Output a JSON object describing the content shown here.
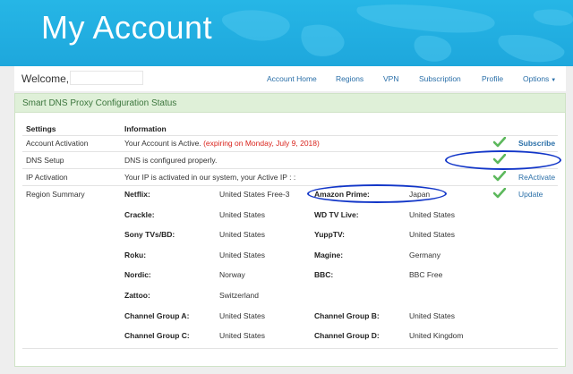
{
  "header": {
    "title": "My Account"
  },
  "navbar": {
    "welcome": "Welcome,",
    "links": [
      "Account Home",
      "Regions",
      "VPN",
      "Subscription",
      "Profile",
      "Options"
    ]
  },
  "panel": {
    "title": "Smart DNS Proxy Configuration Status",
    "col_settings": "Settings",
    "col_information": "Information",
    "rows": [
      {
        "setting": "Account Activation",
        "info": "Your Account is Active.",
        "info_extra": "(expiring on Monday, July 9, 2018)",
        "action": "Subscribe"
      },
      {
        "setting": "DNS Setup",
        "info": "DNS is configured properly.",
        "action": ""
      },
      {
        "setting": "IP Activation",
        "info": "Your IP is activated in our system, your Active IP : :",
        "action": "ReActivate"
      },
      {
        "setting": "Region Summary",
        "info": "",
        "action": "Update"
      }
    ]
  },
  "regions": [
    {
      "service": "Netflix:",
      "region": "United States Free-3"
    },
    {
      "service": "Amazon Prime:",
      "region": "Japan"
    },
    {
      "service": "Crackle:",
      "region": "United States"
    },
    {
      "service": "WD TV Live:",
      "region": "United States"
    },
    {
      "service": "Sony TVs/BD:",
      "region": "United States"
    },
    {
      "service": "YuppTV:",
      "region": "United States"
    },
    {
      "service": "Roku:",
      "region": "United States"
    },
    {
      "service": "Magine:",
      "region": "Germany"
    },
    {
      "service": "Nordic:",
      "region": "Norway"
    },
    {
      "service": "BBC:",
      "region": "BBC Free"
    },
    {
      "service": "Zattoo:",
      "region": "Switzerland"
    },
    {
      "service": "Channel Group A:",
      "region": "United States"
    },
    {
      "service": "Channel Group B:",
      "region": "United States"
    },
    {
      "service": "Channel Group C:",
      "region": "United States"
    },
    {
      "service": "Channel Group D:",
      "region": "United Kingdom"
    }
  ],
  "colors": {
    "banner": "#1ea7dc",
    "link": "#2a6fa8",
    "check": "#5cb85c",
    "annotation": "#1236c8"
  },
  "icons": {
    "status": "check-icon",
    "options": "caret-down-icon"
  }
}
